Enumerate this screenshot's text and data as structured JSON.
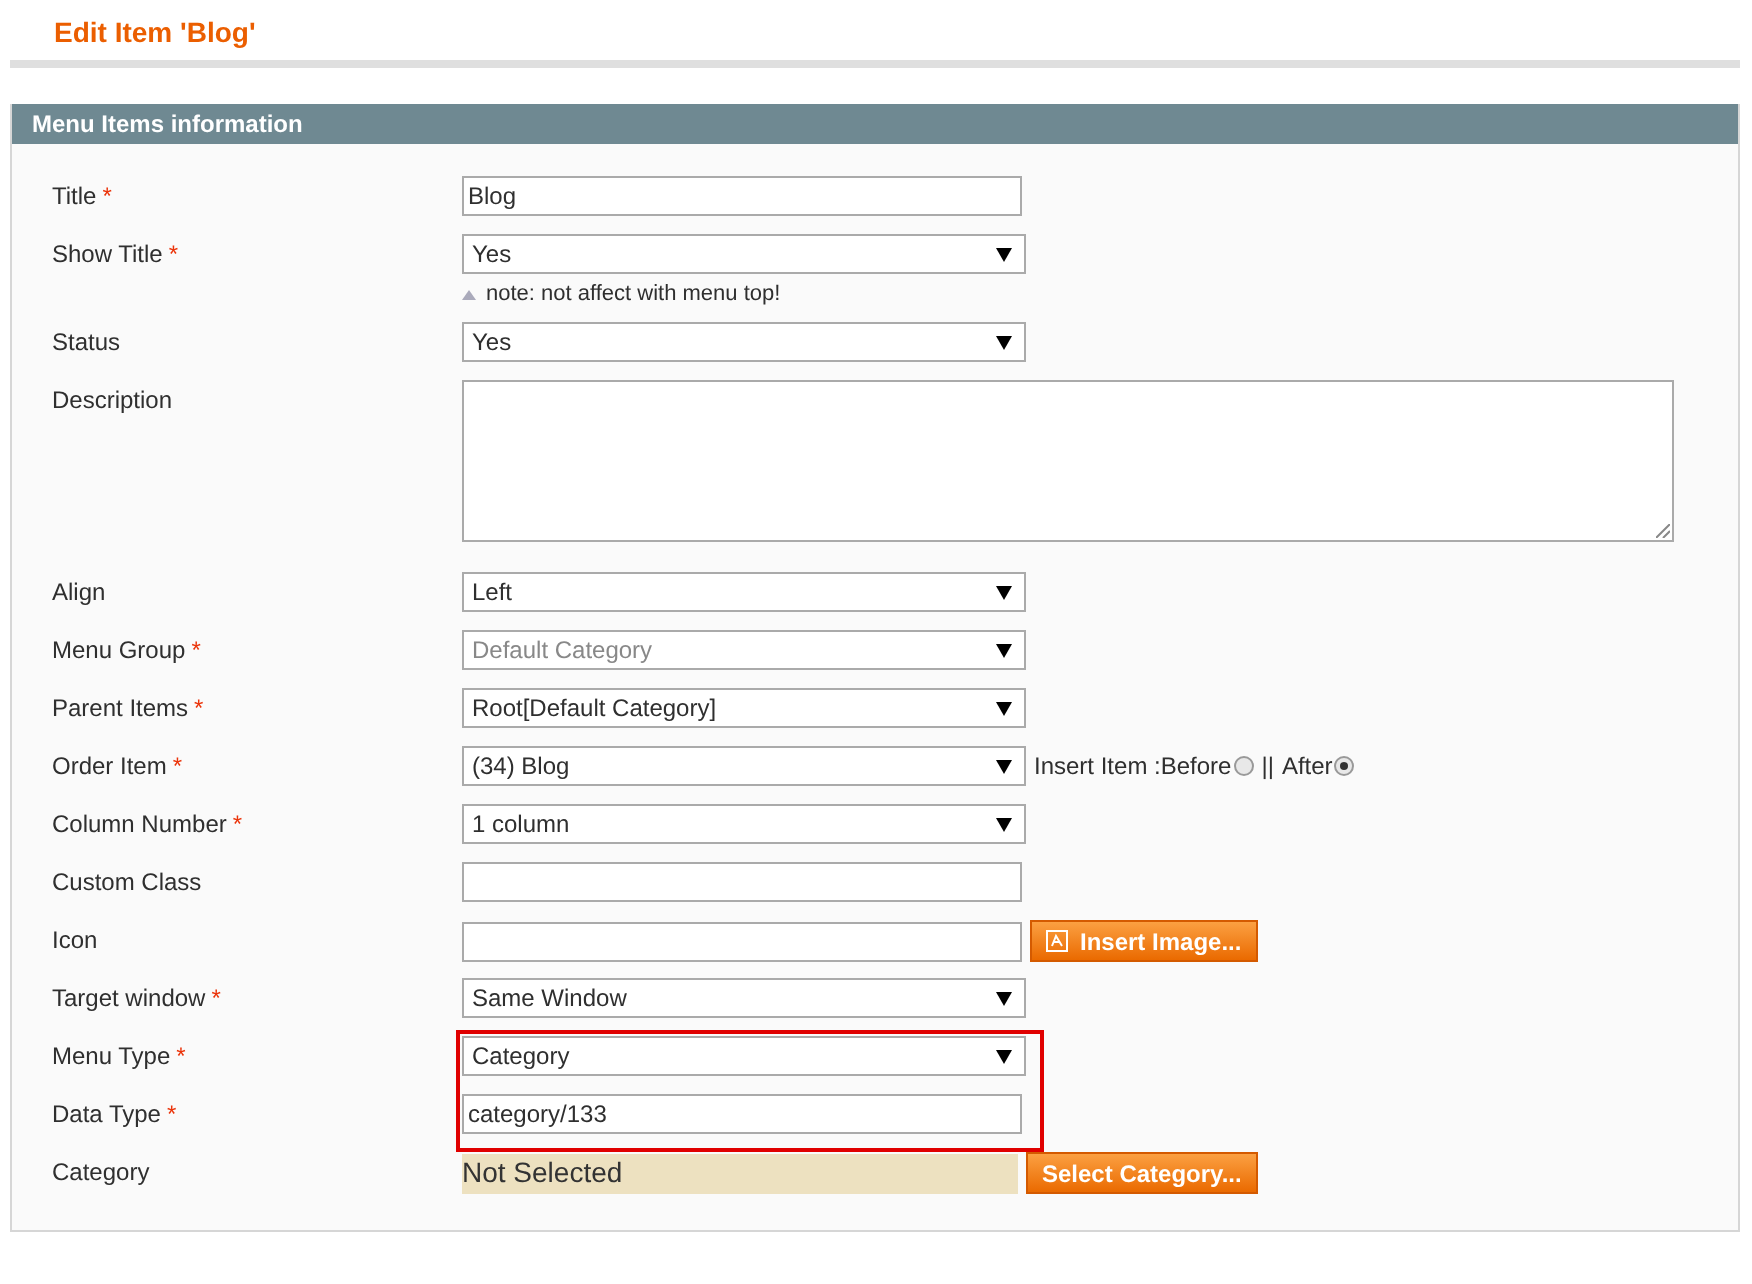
{
  "page_title": "Edit Item 'Blog'",
  "panel": {
    "title": "Menu Items information",
    "rows": [
      {
        "label": "Title",
        "mark": "*",
        "kind": "text",
        "value": "Blog",
        "highlighted": false
      },
      {
        "label": "Show Title",
        "mark": "*",
        "kind": "select",
        "value": "Yes",
        "note": "note: not affect with menu top!",
        "highlighted": false
      },
      {
        "label": "Status",
        "kind": "select",
        "value": "Yes",
        "highlighted": false
      },
      {
        "label": "Description",
        "kind": "textarea",
        "highlighted": false
      },
      {
        "label": "Align",
        "kind": "select",
        "value": "Left",
        "highlighted": false
      },
      {
        "label": "Menu Group",
        "mark": "*",
        "kind": "select",
        "value": "Default Category",
        "disabled": true,
        "highlighted": false
      },
      {
        "label": "Parent Items",
        "mark": "*",
        "kind": "select",
        "value": "Root[Default Category]",
        "highlighted": false
      },
      {
        "label": "Order Item",
        "mark": "*",
        "kind": "select",
        "value": "(34) Blog",
        "insert": {
          "label": "Insert Item : ",
          "separator": "||",
          "options": [
            {
              "label": "Before",
              "selected": false
            },
            {
              "label": "After",
              "selected": true
            }
          ]
        },
        "highlighted": false
      },
      {
        "label": "Column Number",
        "mark": "*",
        "kind": "select",
        "value": "1 column",
        "highlighted": false
      },
      {
        "label": "Custom Class",
        "kind": "text",
        "highlighted": false
      },
      {
        "label": "Icon",
        "kind": "text",
        "button": "Insert Image...",
        "highlighted": false
      },
      {
        "label": "Target window",
        "mark": "*",
        "kind": "select",
        "value": "Same Window",
        "highlighted": false
      },
      {
        "label": "Menu Type",
        "mark": "*",
        "kind": "select",
        "value": "Category",
        "highlighted": true
      },
      {
        "label": "Data Type",
        "mark": "*",
        "kind": "text",
        "value": "category/133",
        "highlighted": true
      },
      {
        "label": "Category",
        "kind": "chooser",
        "value": "Not Selected",
        "button": "Select Category...",
        "highlighted": false
      }
    ]
  }
}
